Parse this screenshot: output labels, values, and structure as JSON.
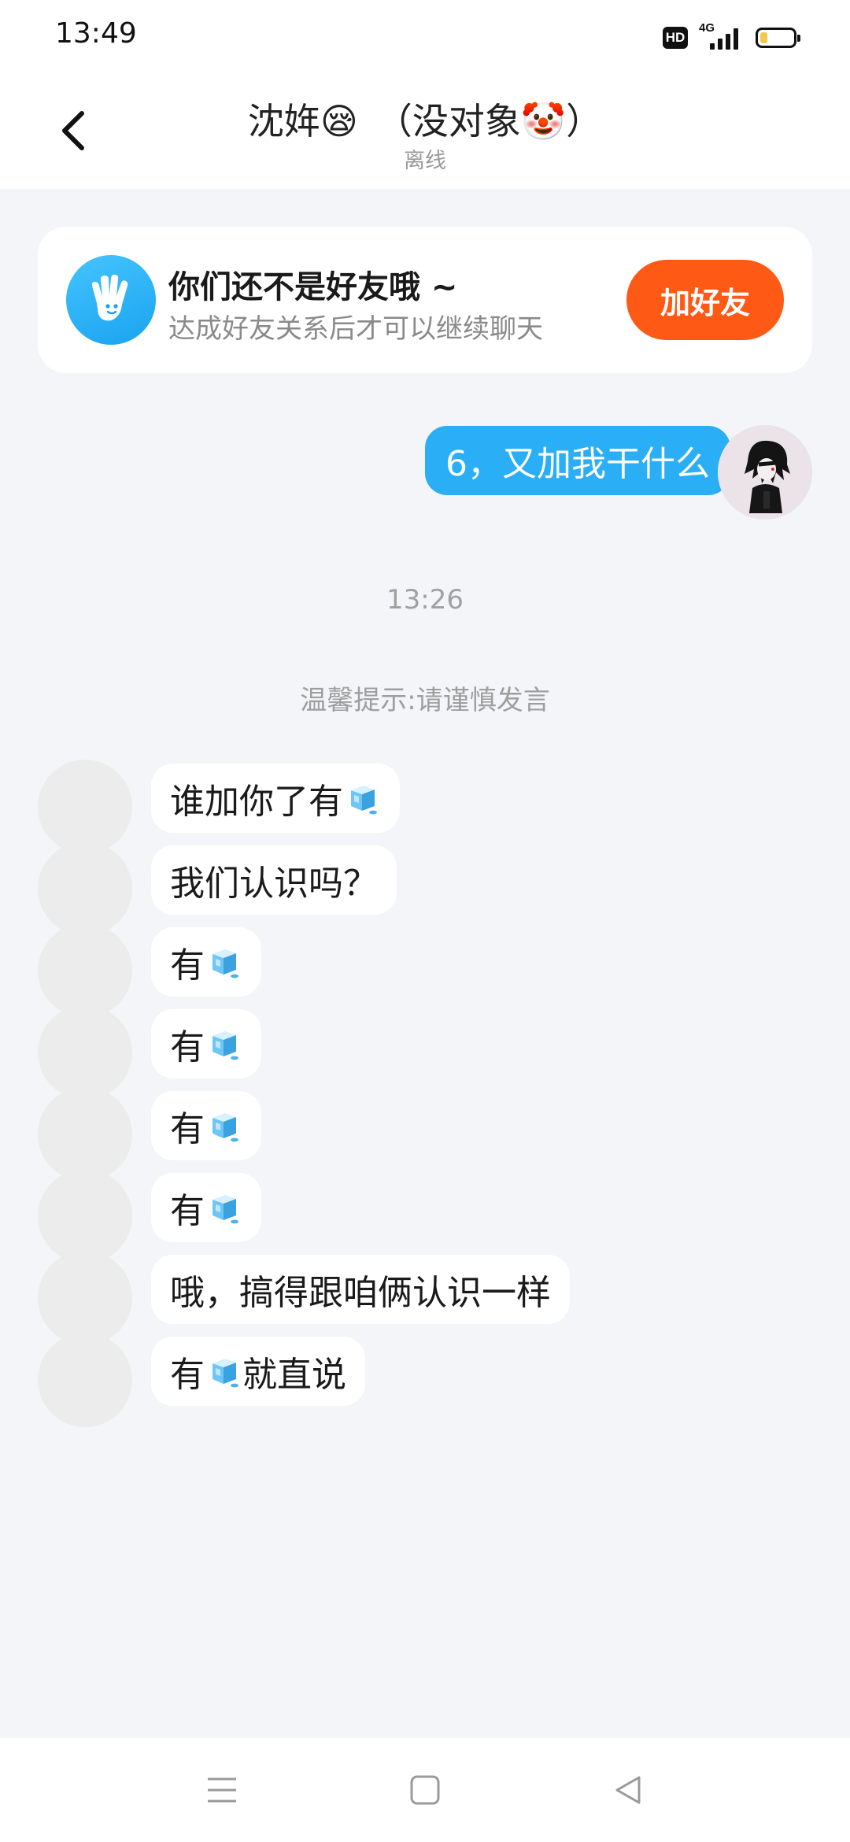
{
  "status_bar": {
    "time": "13:49",
    "hd_badge": "HD",
    "network": "4G",
    "battery_level_fraction": 0.2,
    "icons": [
      "hd-icon",
      "signal-icon",
      "battery-icon"
    ]
  },
  "header": {
    "title": "沈姩😪　（没对象🤡）",
    "subtitle": "离线",
    "back_icon": "chevron-left-icon"
  },
  "friend_card": {
    "icon": "wave-hand-icon",
    "title": "你们还不是好友哦 ~",
    "description": "达成好友关系后才可以继续聊天",
    "button_label": "加好友",
    "accent_color": "#fe5a16"
  },
  "outgoing_message": {
    "text": "6，又加我干什么",
    "bubble_color": "#2aaef6"
  },
  "timestamp": "13:26",
  "tip": "温馨提示:请谨慎发言",
  "incoming_messages": [
    {
      "text": "谁加你了有",
      "ice_emoji": true,
      "suffix": ""
    },
    {
      "text": "我们认识吗？",
      "ice_emoji": false,
      "suffix": ""
    },
    {
      "text": "有",
      "ice_emoji": true,
      "suffix": ""
    },
    {
      "text": "有",
      "ice_emoji": true,
      "suffix": ""
    },
    {
      "text": "有",
      "ice_emoji": true,
      "suffix": ""
    },
    {
      "text": "有",
      "ice_emoji": true,
      "suffix": ""
    },
    {
      "text": "哦，搞得跟咱俩认识一样",
      "ice_emoji": false,
      "suffix": ""
    },
    {
      "text": "有",
      "ice_emoji": true,
      "suffix": "就直说"
    }
  ],
  "navigation_bar": {
    "icons": [
      "menu-icon",
      "home-icon",
      "back-icon"
    ]
  }
}
